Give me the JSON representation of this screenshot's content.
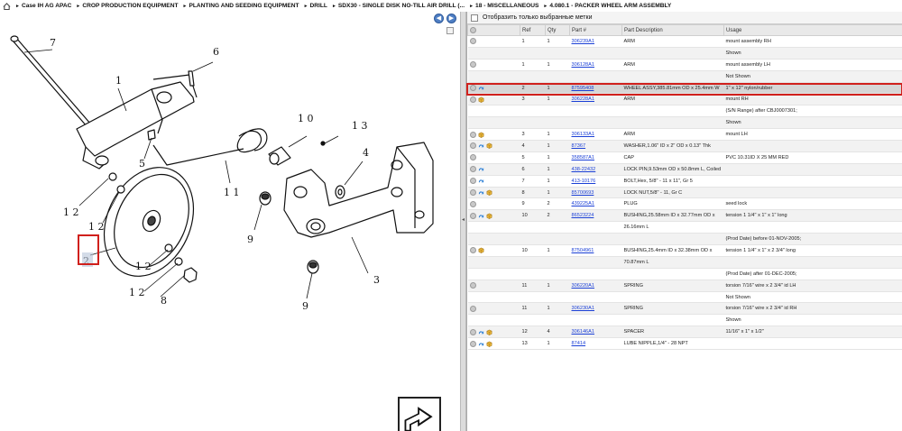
{
  "breadcrumb": {
    "items": [
      "Case IH AG APAC",
      "CROP PRODUCTION EQUIPMENT",
      "PLANTING AND SEEDING EQUIPMENT",
      "DRILL",
      "SDX30 - SINGLE DISK NO-TILL AIR DRILL (...",
      "18 - MISCELLANEOUS",
      "4.080.1 - PACKER WHEEL ARM ASSEMBLY"
    ]
  },
  "diagram": {
    "callouts": [
      "7",
      "6",
      "1",
      "1 0",
      "1 3",
      "5",
      "4",
      "1 1",
      "1 2",
      "1 2",
      "2",
      "9",
      "1 2",
      "1 2",
      "8",
      "3",
      "9"
    ],
    "nav_prev": "◀",
    "nav_next": "▶",
    "splitter_grip": "◂"
  },
  "filter": {
    "label": "Отобразить только выбранные метки"
  },
  "table": {
    "columns": [
      "",
      "Ref",
      "Qty",
      "Part #",
      "Part Description",
      "Usage"
    ],
    "rows": [
      {
        "ref": "1",
        "qty": "1",
        "part": "306239A1",
        "desc": "ARM",
        "usage": "mount assembly RH",
        "arrow": false,
        "box": false
      },
      {
        "ref": "",
        "qty": "",
        "part": "",
        "desc": "",
        "usage": "Shown",
        "arrow": false,
        "box": false
      },
      {
        "ref": "1",
        "qty": "1",
        "part": "306128A1",
        "desc": "ARM",
        "usage": "mount assembly LH",
        "arrow": false,
        "box": false
      },
      {
        "ref": "",
        "qty": "",
        "part": "",
        "desc": "",
        "usage": "Not Shown",
        "arrow": false,
        "box": false
      },
      {
        "ref": "2",
        "qty": "1",
        "part": "87595408",
        "desc": "WHEEL ASSY,385.81mm OD x 25.4mm W",
        "usage": "1\" x 12\" nylon/rubber",
        "arrow": true,
        "box": false
      },
      {
        "ref": "3",
        "qty": "1",
        "part": "306228A1",
        "desc": "ARM",
        "usage": "mount RH",
        "arrow": false,
        "box": true
      },
      {
        "ref": "",
        "qty": "",
        "part": "",
        "desc": "",
        "usage": "(S/N Range) after CBJ0007301;",
        "arrow": false,
        "box": false
      },
      {
        "ref": "",
        "qty": "",
        "part": "",
        "desc": "",
        "usage": "Shown",
        "arrow": false,
        "box": false
      },
      {
        "ref": "3",
        "qty": "1",
        "part": "306133A1",
        "desc": "ARM",
        "usage": "mount LH",
        "arrow": false,
        "box": true
      },
      {
        "ref": "4",
        "qty": "1",
        "part": "87367",
        "desc": "WASHER,1.06\" ID x 2\" OD x 0.13\" Thk",
        "usage": "",
        "arrow": true,
        "box": true
      },
      {
        "ref": "5",
        "qty": "1",
        "part": "358587A1",
        "desc": "CAP",
        "usage": "PVC 10.31ID X 25 MM RED",
        "arrow": false,
        "box": false
      },
      {
        "ref": "6",
        "qty": "1",
        "part": "438-22432",
        "desc": "LOCK PIN,9.53mm OD x 50.8mm L, Coiled",
        "usage": "",
        "arrow": true,
        "box": false
      },
      {
        "ref": "7",
        "qty": "1",
        "part": "413-10176",
        "desc": "BOLT,Hex, 5/8\" - 11 x 11\", Gr 5",
        "usage": "",
        "arrow": true,
        "box": false
      },
      {
        "ref": "8",
        "qty": "1",
        "part": "85700693",
        "desc": "LOCK NUT,5/8\" - 11, Gr C",
        "usage": "",
        "arrow": true,
        "box": true
      },
      {
        "ref": "9",
        "qty": "2",
        "part": "439225A1",
        "desc": "PLUG",
        "usage": "seed lock",
        "arrow": false,
        "box": false
      },
      {
        "ref": "10",
        "qty": "2",
        "part": "86523224",
        "desc": "BUSHING,25.58mm ID x 32.77mm OD x",
        "usage": "tension 1 1/4\" x 1\" x 1\" long",
        "arrow": true,
        "box": true
      },
      {
        "ref": "",
        "qty": "",
        "part": "",
        "desc": "26.16mm L",
        "usage": "",
        "arrow": false,
        "box": false
      },
      {
        "ref": "",
        "qty": "",
        "part": "",
        "desc": "",
        "usage": "(Prod Date) before 01-NOV-2005;",
        "arrow": false,
        "box": false
      },
      {
        "ref": "10",
        "qty": "1",
        "part": "87504961",
        "desc": "BUSHING,25.4mm ID x 32.38mm OD x",
        "usage": "tension 1 1/4\" x 1\" x 2 3/4\" long",
        "arrow": false,
        "box": true
      },
      {
        "ref": "",
        "qty": "",
        "part": "",
        "desc": "70.87mm L",
        "usage": "",
        "arrow": false,
        "box": false
      },
      {
        "ref": "",
        "qty": "",
        "part": "",
        "desc": "",
        "usage": "(Prod Date) after 01-DEC-2005;",
        "arrow": false,
        "box": false
      },
      {
        "ref": "11",
        "qty": "1",
        "part": "306220A1",
        "desc": "SPRING",
        "usage": "torsion 7/16\" wire x 2 3/4\" id LH",
        "arrow": false,
        "box": false
      },
      {
        "ref": "",
        "qty": "",
        "part": "",
        "desc": "",
        "usage": "Not Shown",
        "arrow": false,
        "box": false
      },
      {
        "ref": "11",
        "qty": "1",
        "part": "306230A1",
        "desc": "SPRING",
        "usage": "torsion 7/16\" wire x 2 3/4\" id RH",
        "arrow": false,
        "box": false
      },
      {
        "ref": "",
        "qty": "",
        "part": "",
        "desc": "",
        "usage": "Shown",
        "arrow": false,
        "box": false
      },
      {
        "ref": "12",
        "qty": "4",
        "part": "306146A1",
        "desc": "SPACER",
        "usage": "11/16\" x 1\" x 1/2\"",
        "arrow": true,
        "box": true
      },
      {
        "ref": "13",
        "qty": "1",
        "part": "87414",
        "desc": "LUBE NIPPLE,1/4\" - 28 NPT",
        "usage": "",
        "arrow": true,
        "box": true
      }
    ],
    "highlighted_row": 4
  },
  "colors": {
    "link": "#1a3fd6",
    "highlight_frame": "#d0201c",
    "nav_button": "#4f7fc4"
  }
}
